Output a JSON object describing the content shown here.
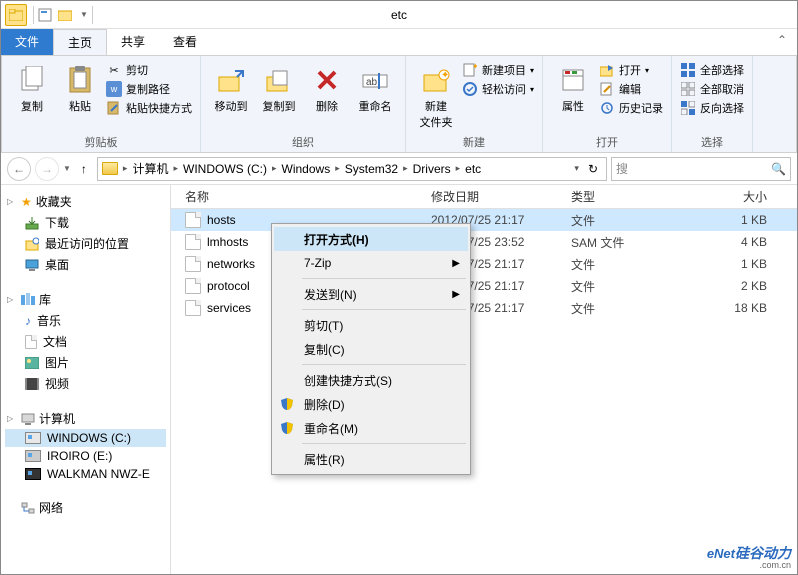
{
  "window": {
    "title": "etc"
  },
  "tabs": {
    "file": "文件",
    "home": "主页",
    "share": "共享",
    "view": "查看"
  },
  "ribbon": {
    "clipboard": {
      "label": "剪贴板",
      "copy": "复制",
      "paste": "粘贴",
      "cut": "剪切",
      "copy_path": "复制路径",
      "paste_shortcut": "粘贴快捷方式"
    },
    "organize": {
      "label": "组织",
      "move_to": "移动到",
      "copy_to": "复制到",
      "delete": "删除",
      "rename": "重命名"
    },
    "new": {
      "label": "新建",
      "new_folder": "新建\n文件夹",
      "new_item": "新建项目",
      "easy_access": "轻松访问"
    },
    "open": {
      "label": "打开",
      "properties": "属性",
      "open": "打开",
      "edit": "编辑",
      "history": "历史记录"
    },
    "select": {
      "label": "选择",
      "select_all": "全部选择",
      "select_none": "全部取消",
      "invert": "反向选择"
    }
  },
  "breadcrumb": [
    "计算机",
    "WINDOWS (C:)",
    "Windows",
    "System32",
    "Drivers",
    "etc"
  ],
  "search": {
    "placeholder": "搜"
  },
  "columns": {
    "name": "名称",
    "date": "修改日期",
    "type": "类型",
    "size": "大小"
  },
  "files": [
    {
      "name": "hosts",
      "date": "2012/07/25 21:17",
      "type": "文件",
      "size": "1 KB",
      "selected": true
    },
    {
      "name": "lmhosts",
      "date": "2012/07/25 23:52",
      "type": "SAM 文件",
      "size": "4 KB"
    },
    {
      "name": "networks",
      "date": "2012/07/25 21:17",
      "type": "文件",
      "size": "1 KB"
    },
    {
      "name": "protocol",
      "date": "2012/07/25 21:17",
      "type": "文件",
      "size": "2 KB"
    },
    {
      "name": "services",
      "date": "2012/07/25 21:17",
      "type": "文件",
      "size": "18 KB"
    }
  ],
  "sidebar": {
    "favorites": {
      "label": "收藏夹",
      "items": [
        "下载",
        "最近访问的位置",
        "桌面"
      ]
    },
    "libraries": {
      "label": "库",
      "items": [
        "音乐",
        "文档",
        "图片",
        "视频"
      ]
    },
    "computer": {
      "label": "计算机",
      "items": [
        "WINDOWS (C:)",
        "IROIRO (E:)",
        "WALKMAN NWZ-E"
      ]
    },
    "network": {
      "label": "网络"
    }
  },
  "context_menu": {
    "open_with": "打开方式(H)",
    "sevenzip": "7-Zip",
    "send_to": "发送到(N)",
    "cut": "剪切(T)",
    "copy": "复制(C)",
    "create_shortcut": "创建快捷方式(S)",
    "delete": "删除(D)",
    "rename": "重命名(M)",
    "properties": "属性(R)"
  },
  "watermark": {
    "brand": "eNet",
    "cn": "硅谷动力",
    "url": ".com.cn"
  }
}
